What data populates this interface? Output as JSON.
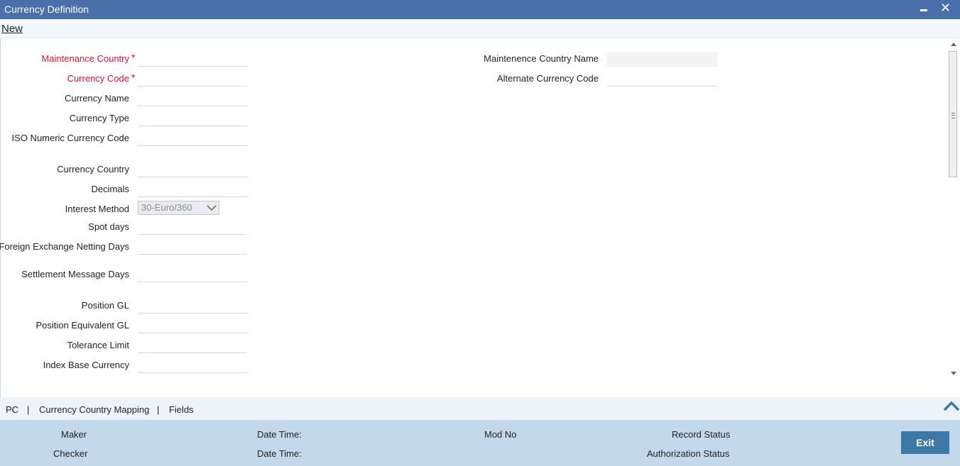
{
  "window": {
    "title": "Currency Definition"
  },
  "toolbar": {
    "new_label": "New"
  },
  "form": {
    "left_fields": [
      {
        "label": "Maintenance Country",
        "required": true
      },
      {
        "label": "Currency Code",
        "required": true
      },
      {
        "label": "Currency Name",
        "required": false
      },
      {
        "label": "Currency Type",
        "required": false
      },
      {
        "label": "ISO Numeric Currency Code",
        "required": false
      },
      {
        "label": "Currency Country",
        "required": false
      },
      {
        "label": "Decimals",
        "required": false
      },
      {
        "label": "Interest Method",
        "required": false,
        "value": "30-Euro/360"
      },
      {
        "label": "Spot days",
        "required": false
      },
      {
        "label": "Foreign Exchange Netting Days",
        "required": false
      },
      {
        "label": "Settlement Message Days",
        "required": false
      },
      {
        "label": "Position GL",
        "required": false
      },
      {
        "label": "Position Equivalent GL",
        "required": false
      },
      {
        "label": "Tolerance Limit",
        "required": false
      },
      {
        "label": "Index Base Currency",
        "required": false
      }
    ],
    "required_marker": "*",
    "right_fields": [
      {
        "label": "Maintenence Country Name"
      },
      {
        "label": "Alternate Currency Code"
      }
    ]
  },
  "links": {
    "items": [
      "PC",
      "Currency Country Mapping",
      "Fields"
    ],
    "separator": "|"
  },
  "audit": {
    "maker": "Maker",
    "checker": "Checker",
    "date_time_1": "Date Time:",
    "date_time_2": "Date Time:",
    "mod_no": "Mod No",
    "record_status": "Record Status",
    "authorization_status": "Authorization Status",
    "exit_label": "Exit"
  },
  "colors": {
    "titlebar": "#4a6fa9",
    "required_label": "#cc1a2e",
    "audit_bar": "#c3d9eb",
    "exit_button": "#3d78a7"
  },
  "icons": [
    "minimize-icon",
    "close-icon",
    "chevron-down-icon",
    "expand-up-icon"
  ]
}
